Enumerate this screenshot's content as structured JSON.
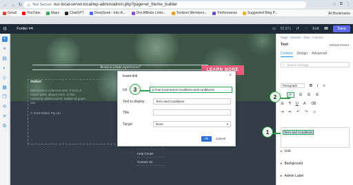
{
  "browser": {
    "not_secure": "Not Secure",
    "url": "our-local-server.local/wp-admin/admin.php?page=et_theme_builder",
    "bookmarks": [
      "Gmail",
      "YouTube",
      "Maps",
      "ChatGPT",
      "DeepSeek - Into th...",
      "Divi Affiliate Links...",
      "Toolizen Members...",
      "Performance",
      "Suggested Blog P..."
    ],
    "all_bookmarks": "All Bookmarks"
  },
  "builder": {
    "title": "Footer #4",
    "zoom": "82.871",
    "exit": "Exit",
    "save": "Save"
  },
  "canvas": {
    "hero_text": "Ready to create experiences?",
    "cta_label": "LEARN MORE",
    "footer_title": "maker",
    "footer_desc": "Maecenas eu placerat ante. Fusce ut neque justo, aliquet enim. In hac habitasse platea dumst. Nullam id quam nisi.",
    "footer_copy": "© 2018 Maker Pty Ltd.",
    "footer_links": [
      "Community Meetups",
      "Help Center",
      "Contact Us"
    ]
  },
  "panel": {
    "breadcrumb": "Page › Section › Row › Column",
    "title": "Text",
    "preset": "Default Preset",
    "tabs": [
      "Content",
      "Design",
      "Advanced"
    ],
    "search_placeholder": "Search settings...",
    "paragraph": "Paragraph",
    "editor_text": "Term and Conditions",
    "sections": [
      "Link",
      "Background",
      "Admin Label"
    ]
  },
  "dialog": {
    "title": "Insert link",
    "url_label": "Url",
    "url_value": "p://our-local-server.local/term-and-conditions/",
    "text_label": "Text to display",
    "text_value": "Term and Conditions",
    "title_label": "Title",
    "title_value": "",
    "target_label": "Target",
    "target_value": "None",
    "ok": "Ok",
    "cancel": "Cancel"
  },
  "callouts": [
    "1",
    "2",
    "3"
  ],
  "colors": {
    "accent_green": "#2ca14b",
    "builder_bar": "#1e2a35",
    "save_button": "#5b68e8",
    "cta": "#e65c7b",
    "ok_button": "#2b6fd6"
  }
}
